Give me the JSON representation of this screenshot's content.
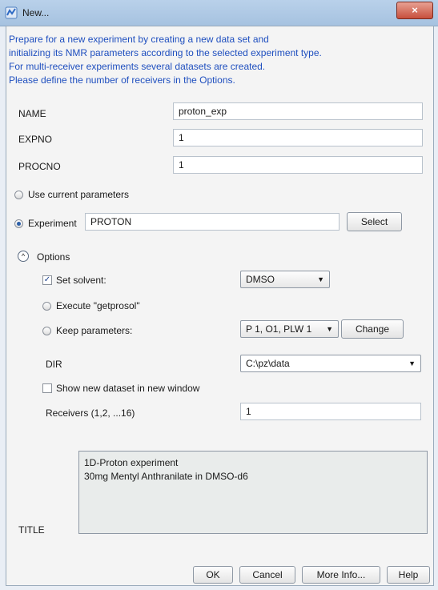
{
  "window": {
    "title": "New...",
    "close_glyph": "×",
    "app_icon": "bruker-app-icon"
  },
  "description": [
    "Prepare for a new experiment by creating a new data set and",
    "initializing its NMR parameters according to the selected experiment type.",
    "For multi-receiver experiments several datasets are created.",
    "Please define the number of receivers in the Options."
  ],
  "fields": {
    "name": {
      "label": "NAME",
      "value": "proton_exp"
    },
    "expno": {
      "label": "EXPNO",
      "value": "1"
    },
    "procno": {
      "label": "PROCNO",
      "value": "1"
    }
  },
  "source": {
    "use_current_label": "Use current parameters",
    "experiment_label": "Experiment",
    "experiment_value": "PROTON",
    "select_label": "Select",
    "selected": "experiment"
  },
  "options": {
    "label": "Options",
    "expander_glyph": "^",
    "set_solvent_label": "Set solvent:",
    "set_solvent_checked": true,
    "solvent_value": "DMSO",
    "execute_label": "Execute \"getprosol\"",
    "keep_label": "Keep parameters:",
    "keep_value": "P 1, O1, PLW 1",
    "change_label": "Change",
    "dir_label": "DIR",
    "dir_value": "C:\\pz\\data",
    "show_new_label": "Show new dataset in new window",
    "show_new_checked": false,
    "receivers_label": "Receivers (1,2, ...16)",
    "receivers_value": "1"
  },
  "title_section": {
    "label": "TITLE",
    "lines": [
      "1D-Proton experiment",
      "30mg Mentyl Anthranilate in DMSO-d6"
    ]
  },
  "buttons": {
    "ok": "OK",
    "cancel": "Cancel",
    "more_info": "More Info...",
    "help": "Help"
  },
  "glyphs": {
    "dropdown": "▼",
    "check": "✓"
  }
}
